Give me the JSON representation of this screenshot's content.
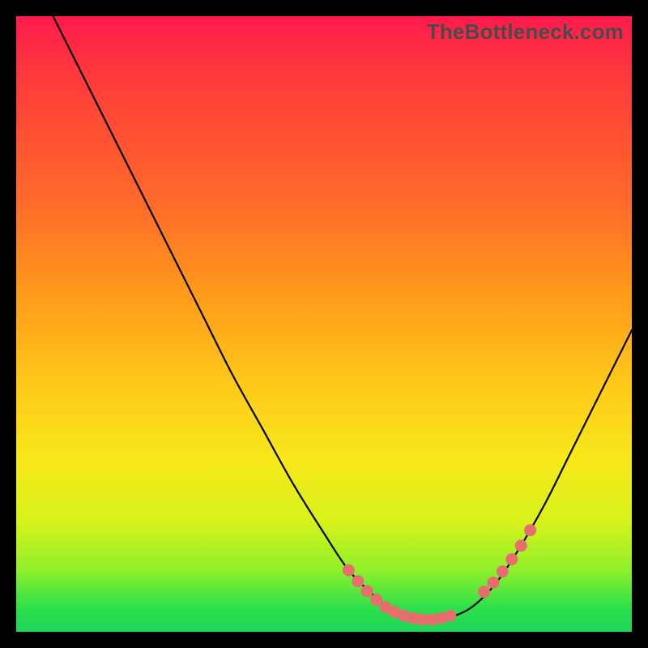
{
  "watermark": "TheBottleneck.com",
  "accent_marker_color": "#e86d6d",
  "curve_color": "#000000",
  "chart_data": {
    "type": "line",
    "title": "",
    "xlabel": "",
    "ylabel": "",
    "xlim": [
      0,
      100
    ],
    "ylim": [
      0,
      100
    ],
    "series": [
      {
        "name": "bottleneck-curve",
        "x": [
          6,
          10,
          15,
          20,
          25,
          30,
          35,
          40,
          45,
          50,
          54,
          58,
          61,
          64,
          67,
          70,
          74,
          78,
          82,
          86,
          90,
          94,
          98,
          100
        ],
        "values": [
          100,
          92,
          82,
          72,
          62,
          52,
          42,
          33,
          24,
          16,
          10,
          6,
          3.5,
          2.2,
          1.8,
          2.2,
          4,
          8,
          14,
          21,
          29,
          37,
          45,
          49
        ]
      }
    ],
    "markers": [
      {
        "x": 54.0,
        "y": 10.0
      },
      {
        "x": 55.5,
        "y": 8.2
      },
      {
        "x": 57.0,
        "y": 6.6
      },
      {
        "x": 58.5,
        "y": 5.2
      },
      {
        "x": 60.0,
        "y": 4.0
      },
      {
        "x": 61.5,
        "y": 3.2
      },
      {
        "x": 63.0,
        "y": 2.6
      },
      {
        "x": 64.5,
        "y": 2.2
      },
      {
        "x": 66.0,
        "y": 2.0
      },
      {
        "x": 67.5,
        "y": 2.0
      },
      {
        "x": 69.0,
        "y": 2.2
      },
      {
        "x": 70.5,
        "y": 2.6
      },
      {
        "x": 76.0,
        "y": 6.5
      },
      {
        "x": 77.5,
        "y": 8.0
      },
      {
        "x": 79.0,
        "y": 9.8
      },
      {
        "x": 80.5,
        "y": 11.8
      },
      {
        "x": 82.0,
        "y": 14.0
      },
      {
        "x": 83.5,
        "y": 16.5
      }
    ]
  }
}
